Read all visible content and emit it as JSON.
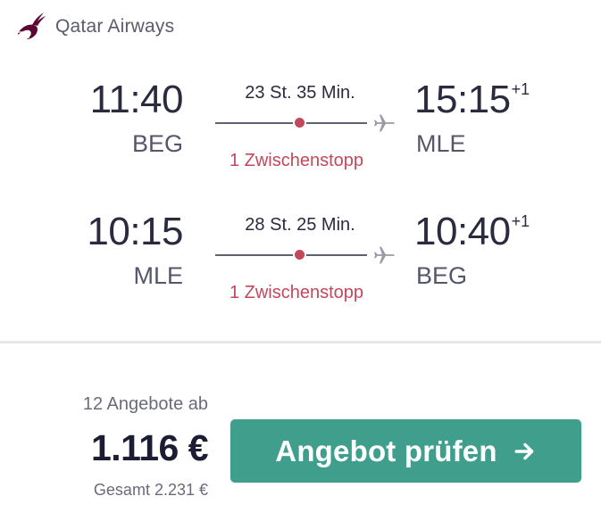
{
  "header": {
    "airline": "Qatar Airways",
    "logo_icon": "qatar-oryx-logo",
    "logo_color": "#5c0632"
  },
  "legs": [
    {
      "departure_time": "11:40",
      "departure_airport": "BEG",
      "duration": "23 St. 35 Min.",
      "stops": "1 Zwischenstopp",
      "arrival_time": "15:15",
      "arrival_day_offset": "+1",
      "arrival_airport": "MLE"
    },
    {
      "departure_time": "10:15",
      "departure_airport": "MLE",
      "duration": "28 St. 25 Min.",
      "stops": "1 Zwischenstopp",
      "arrival_time": "10:40",
      "arrival_day_offset": "+1",
      "arrival_airport": "BEG"
    }
  ],
  "pricing": {
    "offers": "12 Angebote ab",
    "price": "1.116 €",
    "total": "Gesamt 2.231 €"
  },
  "cta": {
    "label": "Angebot prüfen",
    "icon": "arrow-right-icon"
  },
  "colors": {
    "accent_button": "#3f9f8c",
    "stops_red": "#c2485d",
    "text_dark": "#2a2b3d"
  },
  "icons": {
    "route_end": "airplane-icon",
    "stop_marker": "stop-dot"
  }
}
